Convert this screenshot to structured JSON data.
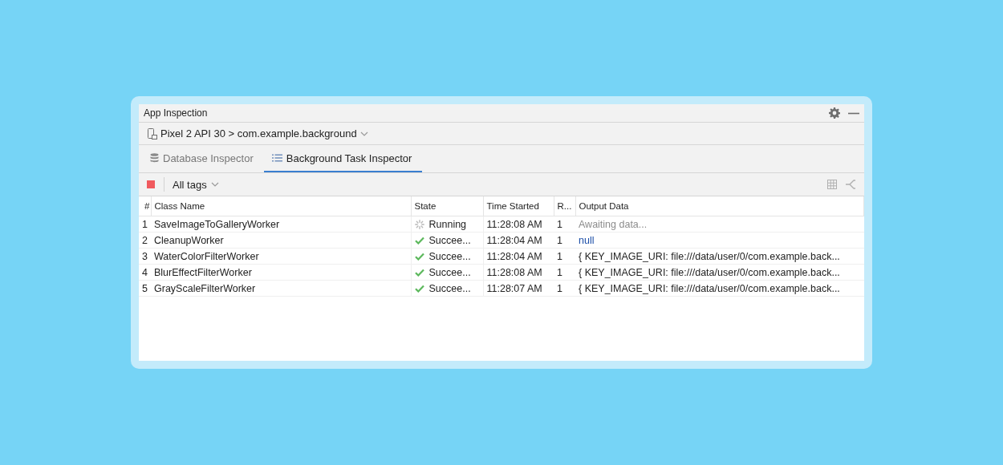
{
  "window": {
    "title": "App Inspection"
  },
  "device_selector": {
    "label": "Pixel 2 API 30 > com.example.background"
  },
  "tabs": [
    {
      "label": "Database Inspector",
      "kind": "database",
      "selected": false
    },
    {
      "label": "Background Task Inspector",
      "kind": "tasks",
      "selected": true
    }
  ],
  "toolbar": {
    "tag_filter": "All tags"
  },
  "table": {
    "columns": [
      "#",
      "Class Name",
      "State",
      "Time Started",
      "R...",
      "Output Data"
    ],
    "rows": [
      {
        "index": "1",
        "class_name": "SaveImageToGalleryWorker",
        "state": {
          "kind": "running",
          "label": "Running"
        },
        "time_started": "11:28:08 AM",
        "retries": "1",
        "output": {
          "kind": "pending",
          "text": "Awaiting data..."
        }
      },
      {
        "index": "2",
        "class_name": "CleanupWorker",
        "state": {
          "kind": "succeeded",
          "label": "Succee..."
        },
        "time_started": "11:28:04 AM",
        "retries": "1",
        "output": {
          "kind": "null",
          "text": "null"
        }
      },
      {
        "index": "3",
        "class_name": "WaterColorFilterWorker",
        "state": {
          "kind": "succeeded",
          "label": "Succee..."
        },
        "time_started": "11:28:04 AM",
        "retries": "1",
        "output": {
          "kind": "value",
          "text": "{ KEY_IMAGE_URI: file:///data/user/0/com.example.back..."
        }
      },
      {
        "index": "4",
        "class_name": "BlurEffectFilterWorker",
        "state": {
          "kind": "succeeded",
          "label": "Succee..."
        },
        "time_started": "11:28:08 AM",
        "retries": "1",
        "output": {
          "kind": "value",
          "text": "{ KEY_IMAGE_URI: file:///data/user/0/com.example.back..."
        }
      },
      {
        "index": "5",
        "class_name": "GrayScaleFilterWorker",
        "state": {
          "kind": "succeeded",
          "label": "Succee..."
        },
        "time_started": "11:28:07 AM",
        "retries": "1",
        "output": {
          "kind": "value",
          "text": "{ KEY_IMAGE_URI: file:///data/user/0/com.example.back..."
        }
      }
    ]
  }
}
